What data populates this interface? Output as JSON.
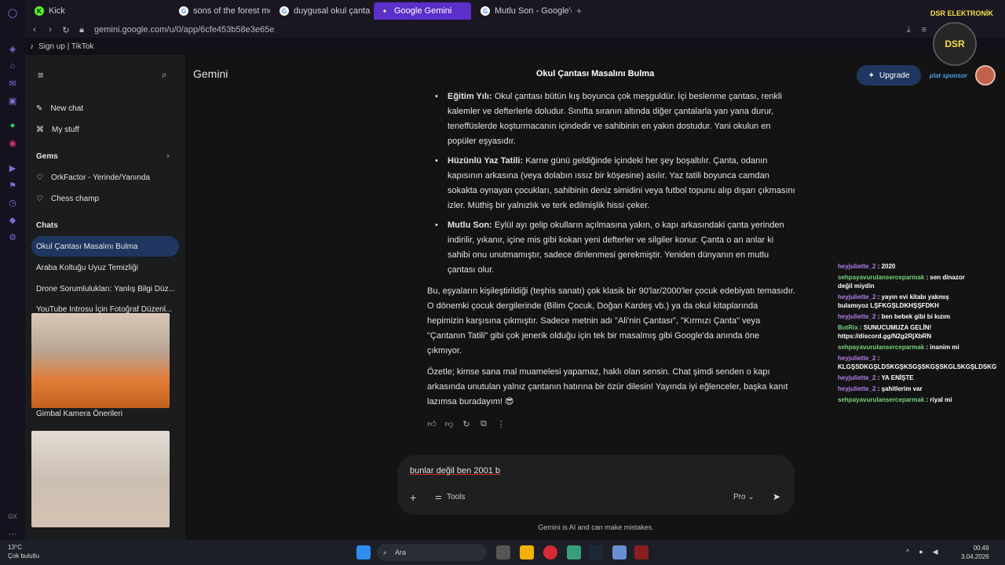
{
  "tabs": [
    {
      "label": "Kick",
      "fav_color": "#53fc18"
    },
    {
      "label": "sons of the forest menu n",
      "fav_color": "#4285f4"
    },
    {
      "label": "duygusal okul çantası mas",
      "fav_color": "#4285f4"
    },
    {
      "label": "Google Gemini",
      "fav_color": "#8ab4f8",
      "active": true
    },
    {
      "label": "Mutlu Son - Google'da Ara",
      "fav_color": "#4285f4"
    }
  ],
  "address": {
    "url": "gemini.google.com/u/0/app/6cfe453b58e3e65e"
  },
  "bookmark": {
    "label": "Sign up | TikTok"
  },
  "app": {
    "brand": "Gemini",
    "chat_title": "Okul Çantası Masalını Bulma",
    "upgrade_label": "Upgrade"
  },
  "sidebar": {
    "new_chat": "New chat",
    "my_stuff": "My stuff",
    "gems_header": "Gems",
    "gems": [
      "OrkFactor - Yerinde/Yanında",
      "Chess champ"
    ],
    "chats_header": "Chats",
    "chats": [
      "Okul Çantası Masalını Bulma",
      "Araba Koltuğu Uyuz Temizliği",
      "Drone Sorumlulukları: Yanlış Bilgi Düz...",
      "YouTube Introsu İçin Fotoğraf Düzenl...",
      "Gimbal Kamera Önerileri"
    ]
  },
  "message": {
    "bullets": [
      {
        "title": "Eğitim Yılı:",
        "text": " Okul çantası bütün kış boyunca çok meşguldür. İçi beslenme çantası, renkli kalemler ve defterlerle doludur. Sınıfta sıranın altında diğer çantalarla yan yana durur, teneffüslerde koşturmacanın içindedir ve sahibinin en yakın dostudur. Yani okulun en popüler eşyasıdır."
      },
      {
        "title": "Hüzünlü Yaz Tatili:",
        "text": " Karne günü geldiğinde içindeki her şey boşaltılır. Çanta, odanın kapısının arkasına (veya dolabın ıssız bir köşesine) asılır. Yaz tatili boyunca camdan sokakta oynayan çocukları, sahibinin deniz simidini veya futbol topunu alıp dışarı çıkmasını izler. Müthiş bir yalnızlık ve terk edilmişlik hissi çeker."
      },
      {
        "title": "Mutlu Son:",
        "text": " Eylül ayı gelip okulların açılmasına yakın, o kapı arkasındaki çanta yerinden indirilir, yıkanır, içine mis gibi kokan yeni defterler ve silgiler konur. Çanta o an anlar ki sahibi onu unutmamıştır, sadece dinlenmesi gerekmiştir. Yeniden dünyanın en mutlu çantası olur."
      }
    ],
    "para1": "Bu, eşyaların kişileştirildiği (teşhis sanatı) çok klasik bir 90'lar/2000'ler çocuk edebiyatı temasıdır. O dönemki çocuk dergilerinde (Bilim Çocuk, Doğan Kardeş vb.) ya da okul kitaplarında hepimizin karşısına çıkmıştır. Sadece metnin adı \"Ali'nin Çantası\", \"Kırmızı Çanta\" veya \"Çantanın Tatili\" gibi çok jenerik olduğu için tek bir masalmış gibi Google'da anında öne çıkmıyor.",
    "para2": "Özetle; kimse sana mal muamelesi yapamaz, haklı olan sensin. Chat şimdi senden o kapı arkasında unutulan yalnız çantanın hatırına bir özür dilesin! Yayında iyi eğlenceler, başka kanıt lazımsa buradayım! 😎"
  },
  "composer": {
    "typed": "bunlar değil ben 2001 b",
    "tools_label": "Tools",
    "model_label": "Pro",
    "disclaimer": "Gemini is AI and can make mistakes."
  },
  "overlay": {
    "logo_text": "DSR ELEKTRONİK",
    "logo_mark": "DSR",
    "sponsor": "plat sponsor",
    "chat": [
      {
        "user": "heyjuliette_2",
        "color": "purple",
        "text": "2020"
      },
      {
        "user": "sehpayavurulanserceparmak",
        "color": "green",
        "text": "sen dinazor değil miydin"
      },
      {
        "user": "heyjuliette_2",
        "color": "purple",
        "text": "yayın evi kitabı yakmış bulamıyoz LŞFKGŞLDKHŞŞFDKH"
      },
      {
        "user": "heyjuliette_2",
        "color": "purple",
        "text": "ben bebek gibi bi kızım"
      },
      {
        "user": "BotRix",
        "color": "green",
        "text": "SUNUCUMUZA GELİN! https://discord.gg/N2g2RjXbRN"
      },
      {
        "user": "sehpayavurulanserceparmak",
        "color": "green",
        "text": "inanim mi"
      },
      {
        "user": "heyjuliette_2",
        "color": "purple",
        "text": "KLGŞSDKGŞLDSKGŞKSGŞSKGŞSKGLSKGŞLDSKG"
      },
      {
        "user": "heyjuliette_2",
        "color": "purple",
        "text": "YA ENİŞTE"
      },
      {
        "user": "heyjuliette_2",
        "color": "purple",
        "text": "şahitlerim var"
      },
      {
        "user": "sehpayavurulanserceparmak",
        "color": "green",
        "text": "riyal mi"
      }
    ]
  },
  "taskbar": {
    "weather_temp": "13°C",
    "weather_desc": "Çok bulutlu",
    "search_placeholder": "Ara",
    "time": "00:49",
    "date": "3.04.2026"
  }
}
